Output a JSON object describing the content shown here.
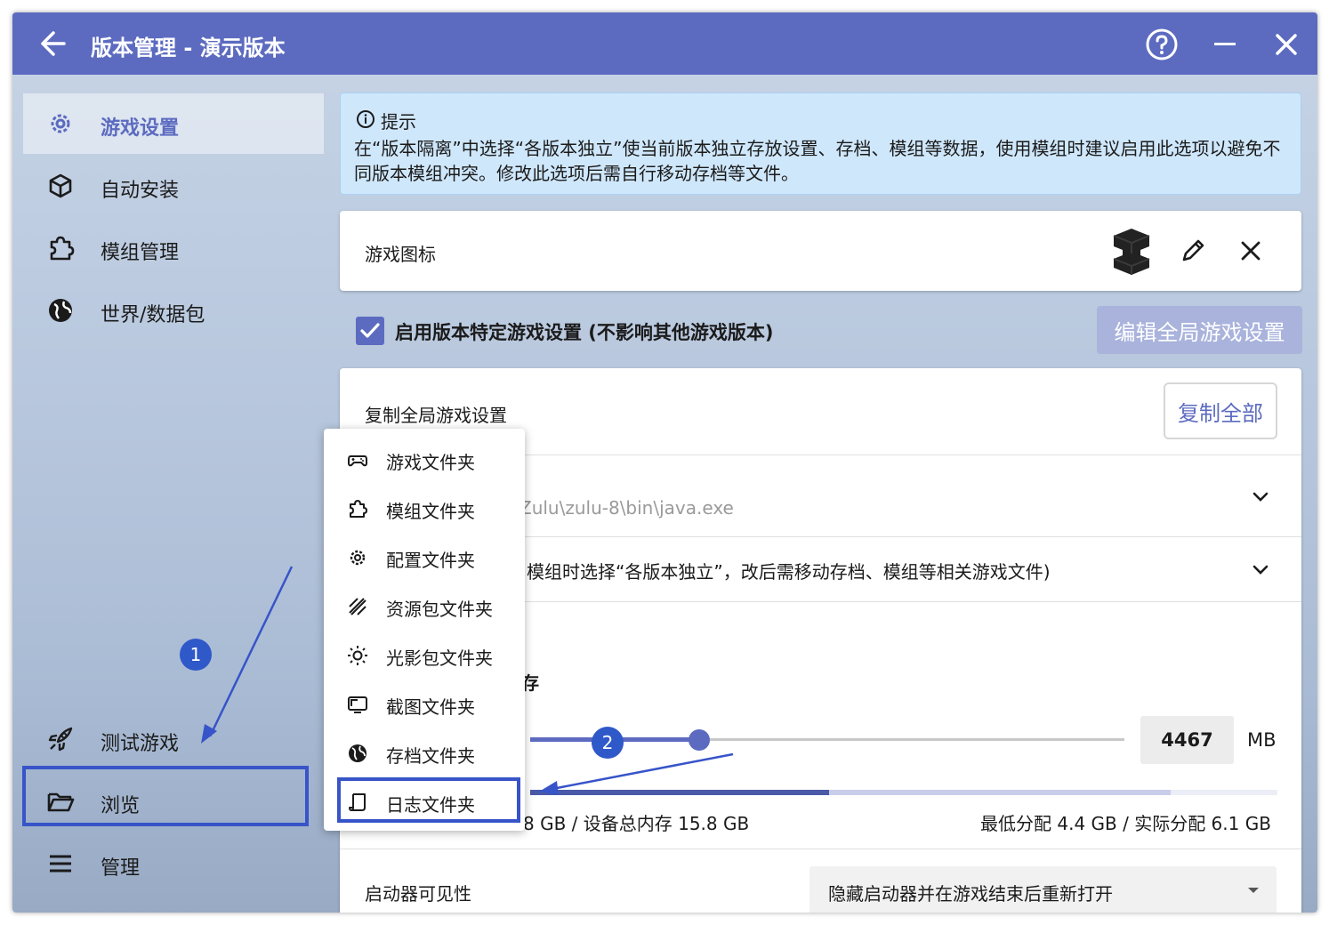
{
  "window": {
    "title": "版本管理 - 演示版本"
  },
  "titlebar": {
    "back_icon": "arrow-left-icon",
    "help_icon": "help-circle-icon",
    "minimize_icon": "minimize-icon",
    "close_icon": "close-icon"
  },
  "sidebar": {
    "items": [
      {
        "label": "游戏设置",
        "icon": "gear-icon",
        "active": true
      },
      {
        "label": "自动安装",
        "icon": "cube-icon"
      },
      {
        "label": "模组管理",
        "icon": "puzzle-icon"
      },
      {
        "label": "世界/数据包",
        "icon": "globe-icon"
      }
    ],
    "bottom_items": [
      {
        "label": "测试游戏",
        "icon": "rocket-icon"
      },
      {
        "label": "浏览",
        "icon": "folder-open-icon"
      },
      {
        "label": "管理",
        "icon": "menu-icon"
      }
    ]
  },
  "hint": {
    "title": "提示",
    "text": "在“版本隔离”中选择“各版本独立”使当前版本独立存放设置、存档、模组等数据，使用模组时建议启用此选项以避免不同版本模组冲突。修改此选项后需自行移动存档等文件。"
  },
  "game_icon": {
    "label": "游戏图标"
  },
  "specific_settings": {
    "checkbox_label": "启用版本特定游戏设置 (不影响其他游戏版本)",
    "checked": true,
    "edit_global_button": "编辑全局游戏设置"
  },
  "settings": {
    "copy_label": "复制全局游戏设置",
    "copy_all_button": "复制全部",
    "java_path": "Zulu\\zulu-8\\bin\\java.exe",
    "isolation_text": "模组时选择“各版本独立”，改后需移动存档、模组等相关游戏文件)",
    "memory_label_fragment": "存",
    "memory_value": "4467",
    "memory_unit": "MB",
    "memory_info_left": "8 GB / 设备总内存 15.8 GB",
    "memory_info_right": "最低分配 4.4 GB / 实际分配 6.1 GB",
    "launcher_visibility_label": "启动器可见性",
    "launcher_visibility_value": "隐藏启动器并在游戏结束后重新打开"
  },
  "browse_menu": {
    "items": [
      {
        "label": "游戏文件夹",
        "icon": "gamepad-icon"
      },
      {
        "label": "模组文件夹",
        "icon": "puzzle-icon"
      },
      {
        "label": "配置文件夹",
        "icon": "gear-icon"
      },
      {
        "label": "资源包文件夹",
        "icon": "texture-icon"
      },
      {
        "label": "光影包文件夹",
        "icon": "sun-icon"
      },
      {
        "label": "截图文件夹",
        "icon": "monitor-icon"
      },
      {
        "label": "存档文件夹",
        "icon": "globe-icon"
      },
      {
        "label": "日志文件夹",
        "icon": "log-scroll-icon"
      }
    ]
  },
  "annotations": {
    "step1": "1",
    "step2": "2"
  },
  "colors": {
    "accent": "#5c6bc0",
    "annotation": "#2f58c9",
    "hint_bg": "#cfe7fb"
  }
}
